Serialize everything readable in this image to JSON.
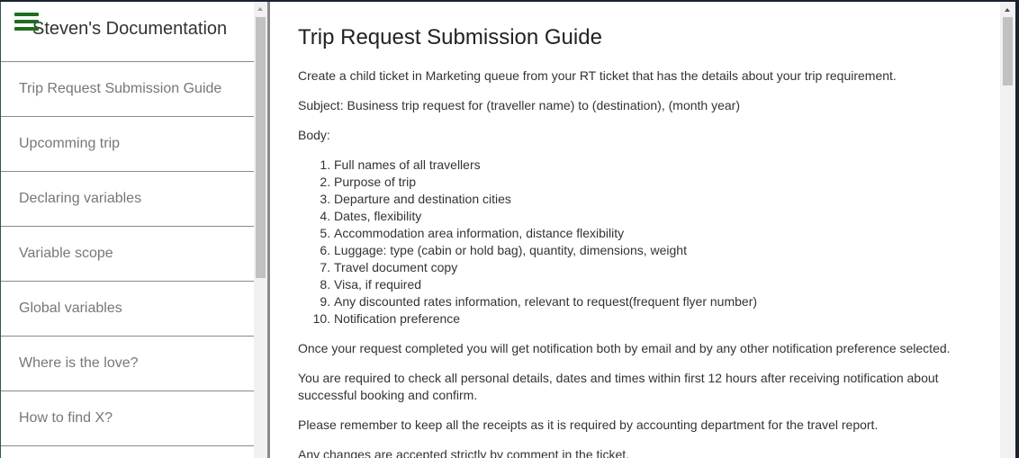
{
  "sidebar": {
    "title": "Steven's Documentation",
    "menu_icon": "hamburger-menu-icon",
    "items": [
      {
        "label": "Trip Request Submission Guide"
      },
      {
        "label": "Upcomming trip"
      },
      {
        "label": "Declaring variables"
      },
      {
        "label": "Variable scope"
      },
      {
        "label": "Global variables"
      },
      {
        "label": "Where is the love?"
      },
      {
        "label": "How to find X?"
      }
    ]
  },
  "main": {
    "heading": "Trip Request Submission Guide",
    "intro": "Create a child ticket in Marketing queue from your RT ticket that has the details about your trip requirement.",
    "subject": "Subject: Business trip request for (traveller name) to (destination), (month year)",
    "body_label": "Body:",
    "list": [
      "Full names of all travellers",
      "Purpose of trip",
      "Departure and destination cities",
      "Dates, flexibility",
      "Accommodation area information, distance flexibility",
      "Luggage: type (cabin or hold bag), quantity, dimensions, weight",
      "Travel document copy",
      "Visa, if required",
      "Any discounted rates information, relevant to request(frequent flyer number)",
      "Notification preference"
    ],
    "para_notification": "Once your request completed you will get notification both by email and by any other notification preference selected.",
    "para_check": "You are required to check all personal details, dates and times within first 12 hours after receiving notification about successful booking and confirm.",
    "para_receipts": "Please remember to keep all the receipts as it is required by accounting department for the travel report.",
    "para_changes": "Any changes are accepted strictly by comment in the ticket."
  },
  "colors": {
    "menu_icon": "#1f6e1f",
    "nav_text": "#777777",
    "nav_border": "#8a8a8a",
    "text": "#333333"
  }
}
